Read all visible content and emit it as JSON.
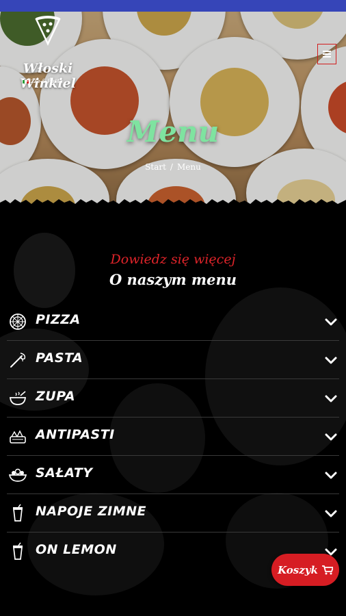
{
  "brand": {
    "name": "Włoski Winkiel",
    "tagline": "Pizza & Pasta"
  },
  "header": {
    "menu_icon": "hamburger-icon"
  },
  "hero": {
    "title": "Menu",
    "breadcrumb": {
      "home": "Start",
      "separator": "/",
      "current": "Menu"
    }
  },
  "intro": {
    "subtitle": "Dowiedz się więcej",
    "title": "O naszym menu"
  },
  "categories": [
    {
      "label": "PIZZA",
      "icon": "pizza-icon"
    },
    {
      "label": "PASTA",
      "icon": "pasta-icon"
    },
    {
      "label": "ZUPA",
      "icon": "soup-icon"
    },
    {
      "label": "ANTIPASTI",
      "icon": "antipasti-icon"
    },
    {
      "label": "SAŁATY",
      "icon": "salad-icon"
    },
    {
      "label": "NAPOJE ZIMNE",
      "icon": "cold-drink-icon"
    },
    {
      "label": "ON LEMON",
      "icon": "lemonade-icon"
    }
  ],
  "cart": {
    "label": "Koszyk",
    "icon": "cart-icon"
  },
  "colors": {
    "status_bar": "#3645b8",
    "title_green": "#7fe3a0",
    "accent_red": "#e0242a",
    "cart_red": "#d61d23"
  }
}
